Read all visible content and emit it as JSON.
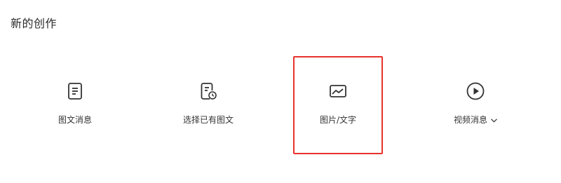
{
  "section": {
    "title": "新的创作"
  },
  "options": [
    {
      "id": "article",
      "label": "图文消息",
      "icon": "document-icon",
      "selected": false
    },
    {
      "id": "existing",
      "label": "选择已有图文",
      "icon": "document-clock-icon",
      "selected": false
    },
    {
      "id": "image_text",
      "label": "图片/文字",
      "icon": "image-icon",
      "selected": true
    },
    {
      "id": "video",
      "label": "视频消息",
      "icon": "play-circle-icon",
      "selected": false,
      "has_dropdown": true
    }
  ],
  "colors": {
    "selected_border": "#e8322c",
    "icon_stroke": "#333333"
  }
}
